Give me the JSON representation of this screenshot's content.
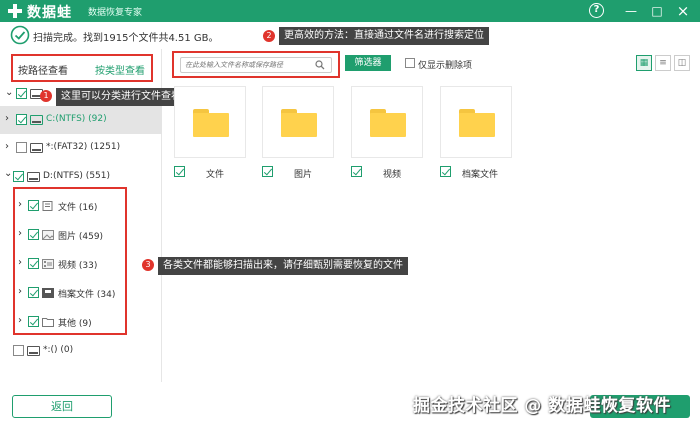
{
  "app": {
    "name": "数据蛙",
    "subtitle": "数据恢复专家"
  },
  "window_controls": {
    "help": "?",
    "minimize": "—",
    "maximize": "□",
    "close": "×"
  },
  "status": {
    "text": "扫描完成。找到1915个文件共4.51 GB。"
  },
  "view_switch": {
    "path_label": "按路径查看",
    "type_label": "按类型查看"
  },
  "tree": [
    {
      "label": "",
      "checked": true
    },
    {
      "label": "C:(NTFS) (92)",
      "checked": true
    },
    {
      "label": "*:(FAT32) (1251)",
      "checked": false
    },
    {
      "label": "D:(NTFS) (551)",
      "checked": true
    },
    {
      "label": "文件 (16)",
      "checked": true
    },
    {
      "label": "图片 (459)",
      "checked": true
    },
    {
      "label": "视频 (33)",
      "checked": true
    },
    {
      "label": "档案文件 (34)",
      "checked": true
    },
    {
      "label": "其他 (9)",
      "checked": true
    },
    {
      "label": "*:() (0)",
      "checked": false
    }
  ],
  "callouts": [
    {
      "number": "1",
      "text": "这里可以分类进行文件查看"
    },
    {
      "number": "2",
      "text": "更高效的方法：直接通过文件名进行搜索定位"
    },
    {
      "number": "3",
      "text": "各类文件都能够扫描出来，请仔细甄别需要恢复的文件"
    }
  ],
  "search": {
    "placeholder": "在此处输入文件名称或保存路径"
  },
  "filter_button": "筛选器",
  "show_deleted": {
    "label": "仅显示删除项",
    "checked": false
  },
  "view_modes": [
    "grid",
    "list",
    "detail"
  ],
  "folders": [
    {
      "label": "文件",
      "checked": true
    },
    {
      "label": "图片",
      "checked": true
    },
    {
      "label": "视频",
      "checked": true
    },
    {
      "label": "档案文件",
      "checked": true
    }
  ],
  "back_button": "返回",
  "watermark": "掘金技术社区 @ 数据蛙恢复软件",
  "colors": {
    "brand": "#1f9e6e",
    "highlight": "#e0342c",
    "folder": "#ffd24d"
  }
}
